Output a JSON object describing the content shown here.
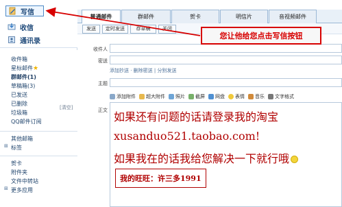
{
  "left_nav": {
    "compose": "写信",
    "inbox": "收信",
    "contacts": "通讯录",
    "folders": [
      {
        "label": "收件箱"
      },
      {
        "label": "星标邮件"
      },
      {
        "label": "群邮件(1)"
      },
      {
        "label": "草稿箱(3)"
      },
      {
        "label": "已发送"
      },
      {
        "label": "已删除"
      },
      {
        "label": "垃圾箱"
      },
      {
        "label": "QQ邮件订阅"
      }
    ],
    "clear": "[清空]",
    "other_folders": "其他邮箱",
    "tags": "标签",
    "bottom_items": [
      {
        "label": "贺卡"
      },
      {
        "label": "附件夹"
      },
      {
        "label": "文件中转站"
      },
      {
        "label": "更多应用"
      }
    ]
  },
  "tabs": [
    "普通邮件",
    "群邮件",
    "贺卡",
    "明信片",
    "音视频邮件"
  ],
  "toolbar": [
    "发送",
    "定时发送",
    "存草稿",
    "关闭"
  ],
  "fields": {
    "to": "收件人",
    "cc": "密送",
    "cc_note": "添加抄送 · 删除密送 | 分别发送",
    "subject": "主题",
    "body": "正文"
  },
  "format_bar": [
    "添加附件",
    "超大附件",
    "照片",
    "截屏",
    "网盘",
    "表情",
    "音乐",
    "文字格式"
  ],
  "editor": {
    "line1": "如果还有问题的话请登录我的淘宝",
    "line2": "xusanduo521.taobao.com!",
    "line3": "如果我在的话我给您解决一下就行哦",
    "wangwang": "我的旺旺：许三多1991"
  },
  "callout": {
    "text": "您让他给您点击写信按钮"
  },
  "colors": {
    "red": "#d70000",
    "blue": "#4d89c5",
    "folder_text": "#22466e"
  }
}
